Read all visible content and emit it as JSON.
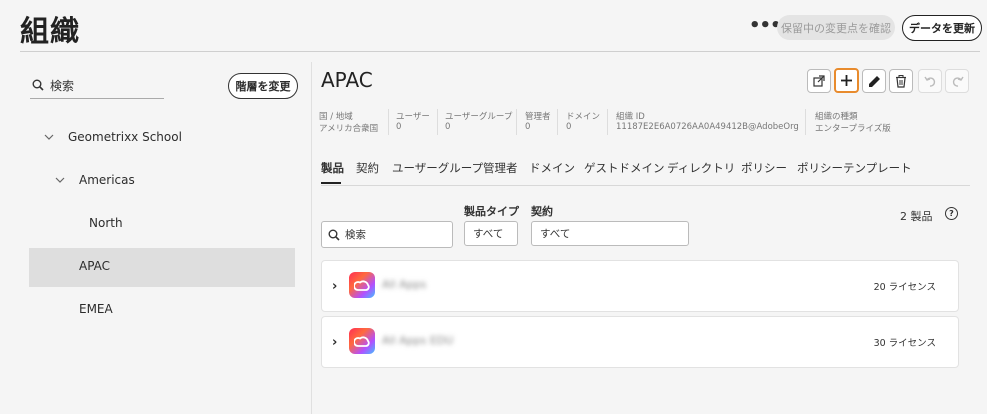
{
  "header": {
    "title": "組織",
    "more_label": "•••",
    "pending_label": "保留中の変更点を確認",
    "refresh_label": "データを更新"
  },
  "sidebar": {
    "search_placeholder": "検索",
    "hierarchy_button": "階層を変更",
    "tree": [
      {
        "label": "Geometrixx School",
        "expanded": true
      },
      {
        "label": "Americas",
        "expanded": true
      },
      {
        "label": "North"
      },
      {
        "label": "APAC",
        "selected": true
      },
      {
        "label": "EMEA"
      }
    ]
  },
  "org": {
    "name": "APAC",
    "meta": [
      {
        "label": "国 / 地域",
        "value": "アメリカ合衆国"
      },
      {
        "label": "ユーザー",
        "value": "0"
      },
      {
        "label": "ユーザーグループ",
        "value": "0"
      },
      {
        "label": "管理者",
        "value": "0"
      },
      {
        "label": "ドメイン",
        "value": "0"
      },
      {
        "label": "組織 ID",
        "value": "11187E2E6A0726AA0A49412B@AdobeOrg"
      },
      {
        "label": "組織の種類",
        "value": "エンタープライズ版"
      }
    ]
  },
  "tabs": [
    "製品",
    "契約",
    "ユーザーグループ",
    "管理者",
    "ドメイン",
    "ゲストドメイン",
    "ディレクトリ",
    "ポリシー",
    "ポリシーテンプレート"
  ],
  "filters": {
    "search_placeholder": "検索",
    "product_type_label": "製品タイプ",
    "product_type_value": "すべて",
    "contract_label": "契約",
    "contract_value": "すべて"
  },
  "product_count": "2 製品",
  "products": [
    {
      "name": "All Apps",
      "licenses": "20 ライセンス"
    },
    {
      "name": "All Apps EDU",
      "licenses": "30 ライセンス"
    }
  ],
  "colors": {
    "highlight": "#e88b2d",
    "selected_row": "#dedede",
    "background": "#f5f5f5"
  }
}
